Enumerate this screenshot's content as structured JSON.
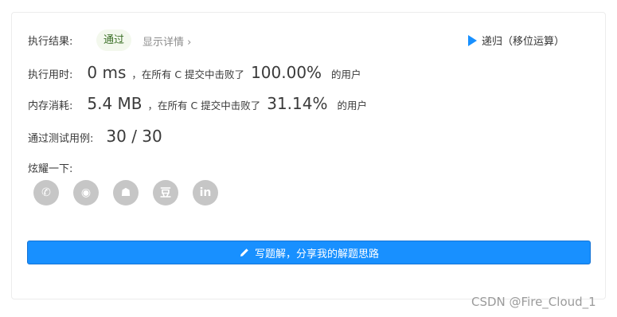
{
  "result": {
    "label": "执行结果:",
    "status": "通过",
    "detail_link": "显示详情 ›",
    "recursion_link": "递归（移位运算）"
  },
  "runtime": {
    "label": "执行用时:",
    "value": "0 ms",
    "beat_text": "，在所有 C 提交中击败了",
    "percent": "100.00%",
    "suffix": "的用户"
  },
  "memory": {
    "label": "内存消耗:",
    "value": "5.4 MB",
    "beat_text": "，在所有 C 提交中击败了",
    "percent": "31.14%",
    "suffix": "的用户"
  },
  "tests": {
    "label": "通过测试用例:",
    "value": "30 / 30"
  },
  "share": {
    "label": "炫耀一下:",
    "icons": [
      {
        "name": "wechat-icon",
        "glyph": "✆"
      },
      {
        "name": "weibo-icon",
        "glyph": "◉"
      },
      {
        "name": "qq-icon",
        "glyph": "☗"
      },
      {
        "name": "douban-icon",
        "glyph": "豆"
      },
      {
        "name": "linkedin-icon",
        "glyph": "in"
      }
    ]
  },
  "write_button": {
    "label": "写题解，分享我的解题思路",
    "icon": "pencil-icon"
  },
  "watermark": "CSDN @Fire_Cloud_1",
  "colors": {
    "accent": "#1890ff",
    "success_bg": "#f3f8ed",
    "icon_gray": "#c6c6c6"
  }
}
